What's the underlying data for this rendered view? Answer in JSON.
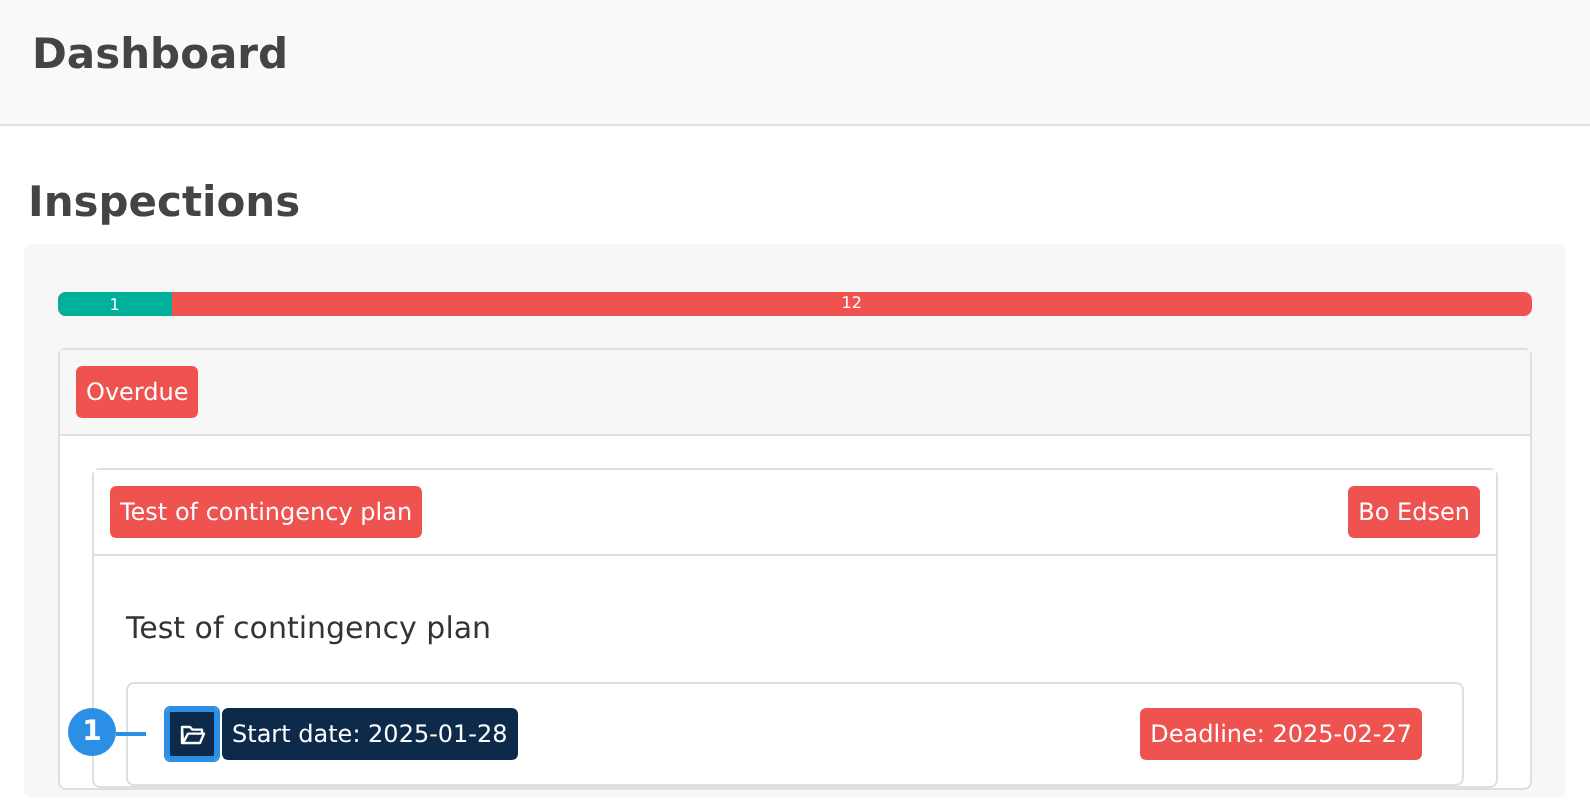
{
  "header": {
    "title": "Dashboard"
  },
  "section": {
    "title": "Inspections"
  },
  "progress": {
    "level": 0.0769,
    "done_label": "1",
    "remaining_label": "12"
  },
  "group": {
    "badge": "Overdue",
    "inspection": {
      "title_badge": "Test of contingency plan",
      "assignee_badge": "Bo Edsen",
      "heading": "Test of contingency plan",
      "task": {
        "start_date": "Start date: 2025-01-28",
        "deadline": "Deadline: 2025-02-27",
        "callout": "1"
      }
    }
  }
}
